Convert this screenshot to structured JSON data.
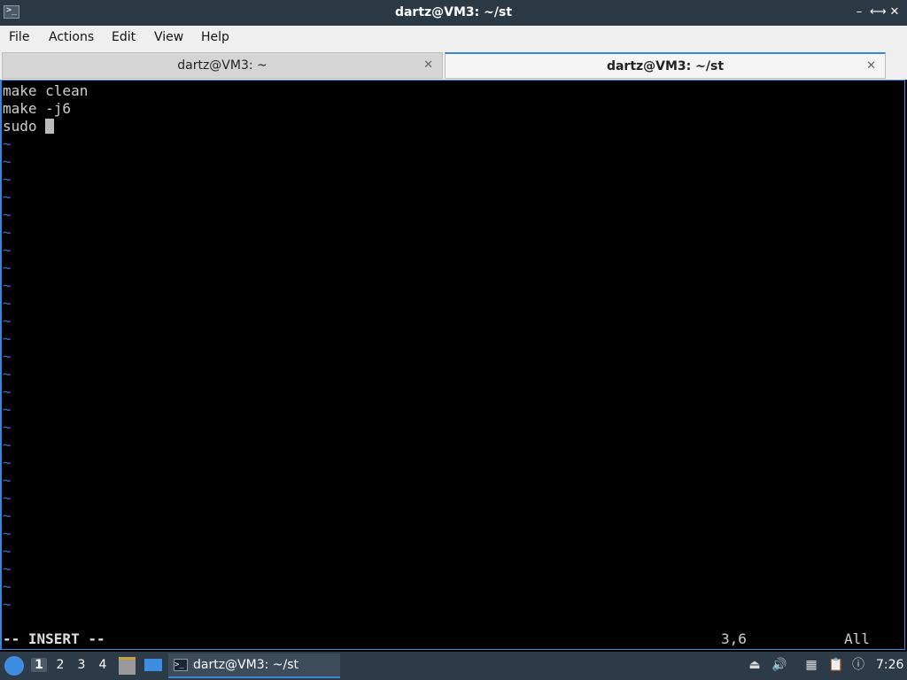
{
  "window": {
    "title": "dartz@VM3: ~/st",
    "app_icon": "terminal-icon",
    "minimize_icon": "minimize-icon",
    "maximize_icon": "maximize-icon",
    "close_icon": "close-icon"
  },
  "menu": {
    "file": "File",
    "actions": "Actions",
    "edit": "Edit",
    "view": "View",
    "help": "Help"
  },
  "tabs": [
    {
      "label": "dartz@VM3: ~",
      "active": false,
      "close": "✕"
    },
    {
      "label": "dartz@VM3: ~/st",
      "active": true,
      "close": "✕"
    }
  ],
  "editor": {
    "lines": [
      "make clean",
      "make -j6",
      "sudo "
    ],
    "tilde": "~",
    "tilde_count": 27,
    "mode": "-- INSERT --",
    "position": "3,6",
    "scroll": "All"
  },
  "taskbar": {
    "workspaces": [
      "1",
      "2",
      "3",
      "4"
    ],
    "active_workspace": "1",
    "task_label": "dartz@VM3: ~/st",
    "clock": "7:26"
  },
  "colors": {
    "titlebar": "#2b3945",
    "accent": "#3a86d6",
    "tilde": "#3b6fd8",
    "taskbar": "#2d3b48"
  }
}
